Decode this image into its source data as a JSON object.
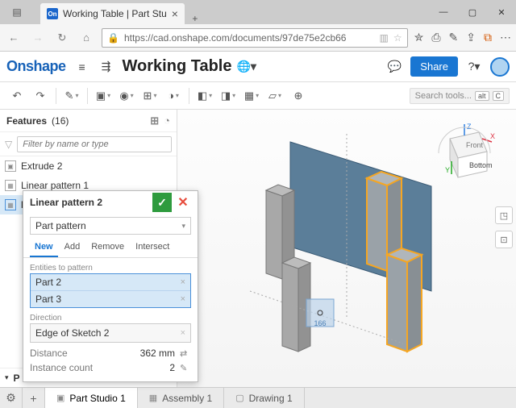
{
  "browser": {
    "tab_title": "Working Table | Part Stu",
    "url": "https://cad.onshape.com/documents/97de75e2cb66"
  },
  "header": {
    "logo": "Onshape",
    "doc_title": "Working Table",
    "share": "Share"
  },
  "toolbar": {
    "search_placeholder": "Search tools...",
    "shortcut_alt": "alt",
    "shortcut_c": "C"
  },
  "features": {
    "title": "Features",
    "count": "(16)",
    "filter_placeholder": "Filter by name or type",
    "items": [
      {
        "name": "Extrude 2"
      },
      {
        "name": "Linear pattern 1"
      }
    ]
  },
  "dialog": {
    "title": "Linear pattern 2",
    "pattern_type": "Part pattern",
    "tabs": {
      "new": "New",
      "add": "Add",
      "remove": "Remove",
      "intersect": "Intersect"
    },
    "entities_label": "Entities to pattern",
    "entities": [
      "Part 2",
      "Part 3"
    ],
    "direction_label": "Direction",
    "direction_value": "Edge of Sketch 2",
    "distance_label": "Distance",
    "distance_value": "362 mm",
    "count_label": "Instance count",
    "count_value": "2"
  },
  "viewcube": {
    "front": "Front",
    "bottom": "Bottom",
    "x": "X",
    "y": "Y",
    "z": "Z"
  },
  "viewport": {
    "manipulator_label": "166"
  },
  "tabs": {
    "studio": "Part Studio 1",
    "assembly": "Assembly 1",
    "drawing": "Drawing 1"
  },
  "parts_heading": "P"
}
